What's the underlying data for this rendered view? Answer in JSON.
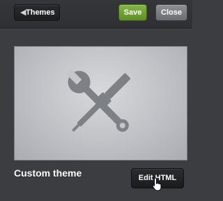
{
  "header": {
    "back_label": "Themes",
    "back_icon": "chevron-left-icon",
    "save_label": "Save",
    "close_label": "Close"
  },
  "theme": {
    "name": "Custom theme",
    "preview_icon": "tools-icon",
    "edit_label": "Edit HTML"
  },
  "cursor": {
    "icon": "hand-pointer-icon"
  },
  "colors": {
    "save_button": "#6f9f34",
    "close_button": "#7c7f84",
    "background": "#3b3d40"
  }
}
